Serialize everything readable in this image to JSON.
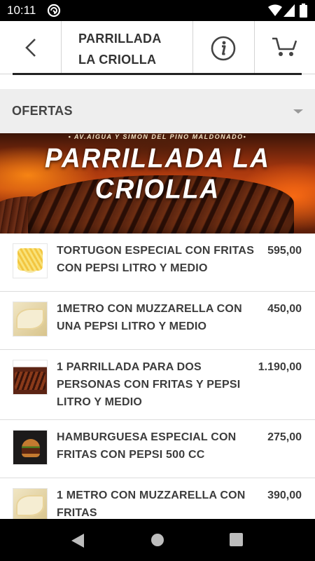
{
  "status_bar": {
    "time": "10:11",
    "icons": [
      "sync-icon",
      "wifi-icon",
      "signal-icon",
      "battery-icon"
    ]
  },
  "header": {
    "title_line1": "PARRILLADA",
    "title_line2": "LA CRIOLLA",
    "back_icon": "chevron-left-icon",
    "info_icon": "info-icon",
    "cart_icon": "cart-icon"
  },
  "category": {
    "label": "OFERTAS",
    "caret_icon": "caret-down-icon"
  },
  "banner": {
    "address": "• AV.AIGUA Y SIMON DEL PINO MALDONADO•",
    "brand": "PARRILLADA LA CRIOLLA"
  },
  "products": [
    {
      "name": "TORTUGON ESPECIAL CON FRITAS CON PEPSI LITRO Y MEDIO",
      "price": "595,00",
      "thumb": "fries"
    },
    {
      "name": "1METRO CON MUZZARELLA CON UNA PEPSI LITRO Y MEDIO",
      "price": "450,00",
      "thumb": "pizza"
    },
    {
      "name": "1 PARRILLADA PARA DOS PERSONAS CON FRITAS Y PEPSI LITRO Y MEDIO",
      "price": "1.190,00",
      "thumb": "grill"
    },
    {
      "name": "HAMBURGUESA ESPECIAL CON FRITAS CON PEPSI 500 CC",
      "price": "275,00",
      "thumb": "burger"
    },
    {
      "name": "1 METRO CON MUZZARELLA CON FRITAS",
      "price": "390,00",
      "thumb": "pizza"
    }
  ],
  "nav_bar": {
    "icons": [
      "back-nav-icon",
      "home-nav-icon",
      "recents-nav-icon"
    ]
  },
  "colors": {
    "text": "#3c3c3c",
    "category_bg": "#eeeeee",
    "divider": "#dcdcdc"
  }
}
